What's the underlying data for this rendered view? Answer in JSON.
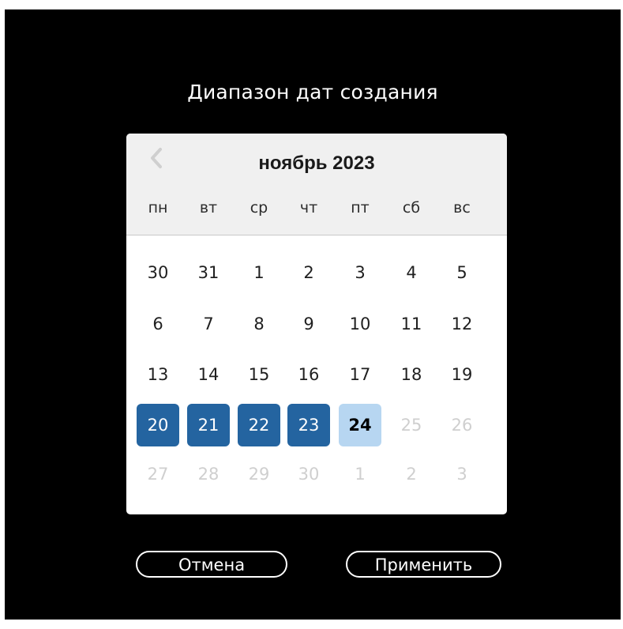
{
  "dialog": {
    "title": "Диапазон дат создания"
  },
  "calendar": {
    "month_label": "ноябрь 2023",
    "prev_icon": "chevron-left-icon",
    "weekdays": [
      "пн",
      "вт",
      "ср",
      "чт",
      "пт",
      "сб",
      "вс"
    ],
    "weeks": [
      [
        {
          "label": "30",
          "state": "normal"
        },
        {
          "label": "31",
          "state": "normal"
        },
        {
          "label": "1",
          "state": "normal"
        },
        {
          "label": "2",
          "state": "normal"
        },
        {
          "label": "3",
          "state": "normal"
        },
        {
          "label": "4",
          "state": "normal"
        },
        {
          "label": "5",
          "state": "normal"
        }
      ],
      [
        {
          "label": "6",
          "state": "normal"
        },
        {
          "label": "7",
          "state": "normal"
        },
        {
          "label": "8",
          "state": "normal"
        },
        {
          "label": "9",
          "state": "normal"
        },
        {
          "label": "10",
          "state": "normal"
        },
        {
          "label": "11",
          "state": "normal"
        },
        {
          "label": "12",
          "state": "normal"
        }
      ],
      [
        {
          "label": "13",
          "state": "normal"
        },
        {
          "label": "14",
          "state": "normal"
        },
        {
          "label": "15",
          "state": "normal"
        },
        {
          "label": "16",
          "state": "normal"
        },
        {
          "label": "17",
          "state": "normal"
        },
        {
          "label": "18",
          "state": "normal"
        },
        {
          "label": "19",
          "state": "normal"
        }
      ],
      [
        {
          "label": "20",
          "state": "selected"
        },
        {
          "label": "21",
          "state": "selected"
        },
        {
          "label": "22",
          "state": "selected"
        },
        {
          "label": "23",
          "state": "selected"
        },
        {
          "label": "24",
          "state": "today"
        },
        {
          "label": "25",
          "state": "disabled"
        },
        {
          "label": "26",
          "state": "disabled"
        }
      ],
      [
        {
          "label": "27",
          "state": "disabled"
        },
        {
          "label": "28",
          "state": "disabled"
        },
        {
          "label": "29",
          "state": "disabled"
        },
        {
          "label": "30",
          "state": "disabled"
        },
        {
          "label": "1",
          "state": "disabled"
        },
        {
          "label": "2",
          "state": "disabled"
        },
        {
          "label": "3",
          "state": "disabled"
        }
      ]
    ]
  },
  "actions": {
    "cancel_label": "Отмена",
    "apply_label": "Применить"
  },
  "colors": {
    "background": "#000000",
    "selected": "#2464a0",
    "today": "#b7d6f1",
    "disabled_text": "#cfcfcf"
  }
}
